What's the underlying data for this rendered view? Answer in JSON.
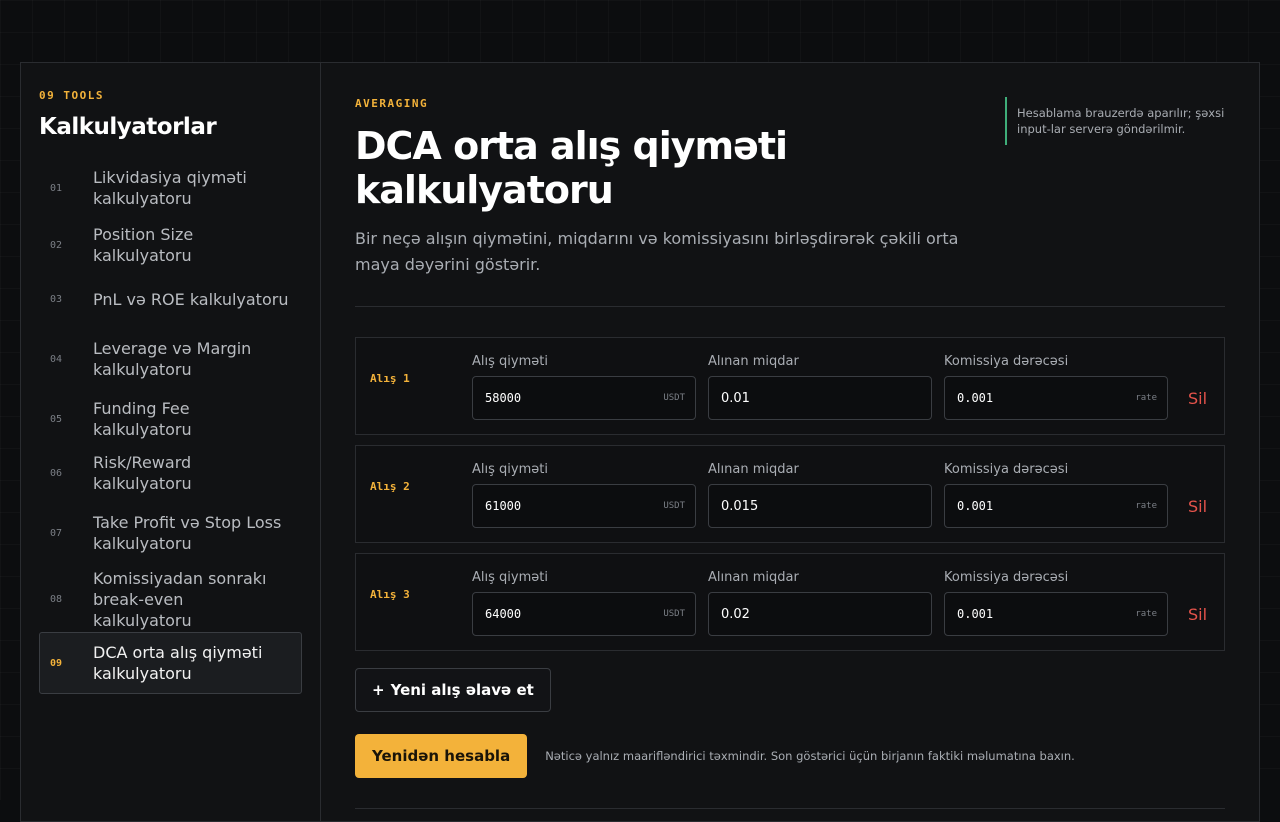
{
  "sidebar": {
    "kicker": "09 TOOLS",
    "title": "Kalkulyatorlar",
    "items": [
      {
        "num": "01",
        "label": "Likvidasiya qiyməti kalkulyatoru"
      },
      {
        "num": "02",
        "label": "Position Size kalkulyatoru"
      },
      {
        "num": "03",
        "label": "PnL və ROE kalkulyatoru"
      },
      {
        "num": "04",
        "label": "Leverage və Margin kalkulyatoru"
      },
      {
        "num": "05",
        "label": "Funding Fee kalkulyatoru"
      },
      {
        "num": "06",
        "label": "Risk/Reward kalkulyatoru"
      },
      {
        "num": "07",
        "label": "Take Profit və Stop Loss kalkulyatoru"
      },
      {
        "num": "08",
        "label": "Komissiyadan sonrakı break-even kalkulyatoru"
      },
      {
        "num": "09",
        "label": "DCA orta alış qiyməti kalkulyatoru"
      }
    ],
    "active_index": 8
  },
  "main": {
    "kicker": "AVERAGING",
    "title": "DCA orta alış qiyməti kalkulyatoru",
    "description": "Bir neçə alışın qiymətini, miqdarını və komissiyasını birləşdirərək çəkili orta maya dəyərini göstərir.",
    "privacy_note": "Hesablama brauzerdə aparılır; şəxsi input-lar serverə göndərilmir."
  },
  "purchases": [
    {
      "label": "Alış 1",
      "price_label": "Alış qiyməti",
      "price": "58000",
      "price_unit": "USDT",
      "qty_label": "Alınan miqdar",
      "qty": "0.01",
      "fee_label": "Komissiya dərəcəsi",
      "fee": "0.001",
      "fee_unit": "rate",
      "delete_label": "Sil"
    },
    {
      "label": "Alış 2",
      "price_label": "Alış qiyməti",
      "price": "61000",
      "price_unit": "USDT",
      "qty_label": "Alınan miqdar",
      "qty": "0.015",
      "fee_label": "Komissiya dərəcəsi",
      "fee": "0.001",
      "fee_unit": "rate",
      "delete_label": "Sil"
    },
    {
      "label": "Alış 3",
      "price_label": "Alış qiyməti",
      "price": "64000",
      "price_unit": "USDT",
      "qty_label": "Alınan miqdar",
      "qty": "0.02",
      "fee_label": "Komissiya dərəcəsi",
      "fee": "0.001",
      "fee_unit": "rate",
      "delete_label": "Sil"
    }
  ],
  "add_button": {
    "icon": "+",
    "label": "Yeni alış əlavə et"
  },
  "recalc_button": {
    "label": "Yenidən hesabla"
  },
  "disclaimer": "Nəticə yalnız maarifləndirici təxmindir. Son göstərici üçün birjanın faktiki məlumatına baxın.",
  "colors": {
    "accent": "#f3b23a",
    "danger": "#e5534b",
    "note_border": "#3fae7a"
  }
}
